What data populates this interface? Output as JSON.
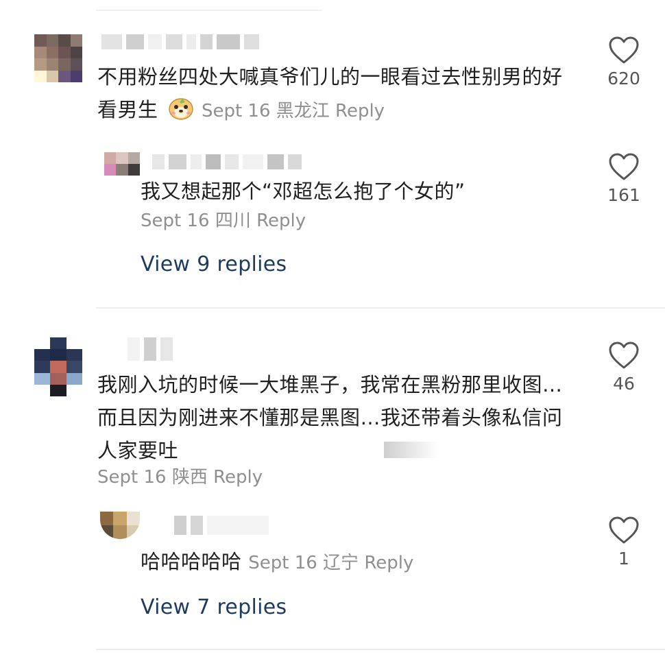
{
  "comments": [
    {
      "text": "不用粉丝四处大喊真爷们儿的一眼看过去性别男的好看男生",
      "emoji": "dog-emoji",
      "date": "Sept 16",
      "location": "黑龙江",
      "reply_label": "Reply",
      "likes": "620",
      "replies": [
        {
          "text": "我又想起那个“邓超怎么抱了个女的”",
          "date": "Sept 16",
          "location": "四川",
          "reply_label": "Reply",
          "likes": "161"
        }
      ],
      "view_replies": "View 9 replies"
    },
    {
      "text": "我刚入坑的时候一大堆黑子，我常在黑粉那里收图…而且因为刚进来不懂那是黑图…我还带着头像私信问人家要吐",
      "date": "Sept 16",
      "location": "陕西",
      "reply_label": "Reply",
      "likes": "46",
      "replies": [
        {
          "text": "哈哈哈哈哈",
          "date": "Sept 16",
          "location": "辽宁",
          "reply_label": "Reply",
          "likes": "1"
        }
      ],
      "view_replies": "View 7 replies"
    }
  ],
  "colors": {
    "link": "#1d3a5f",
    "meta": "#8f8f8f",
    "divider": "#ededed"
  },
  "icons": {
    "like": "heart-outline-icon"
  }
}
